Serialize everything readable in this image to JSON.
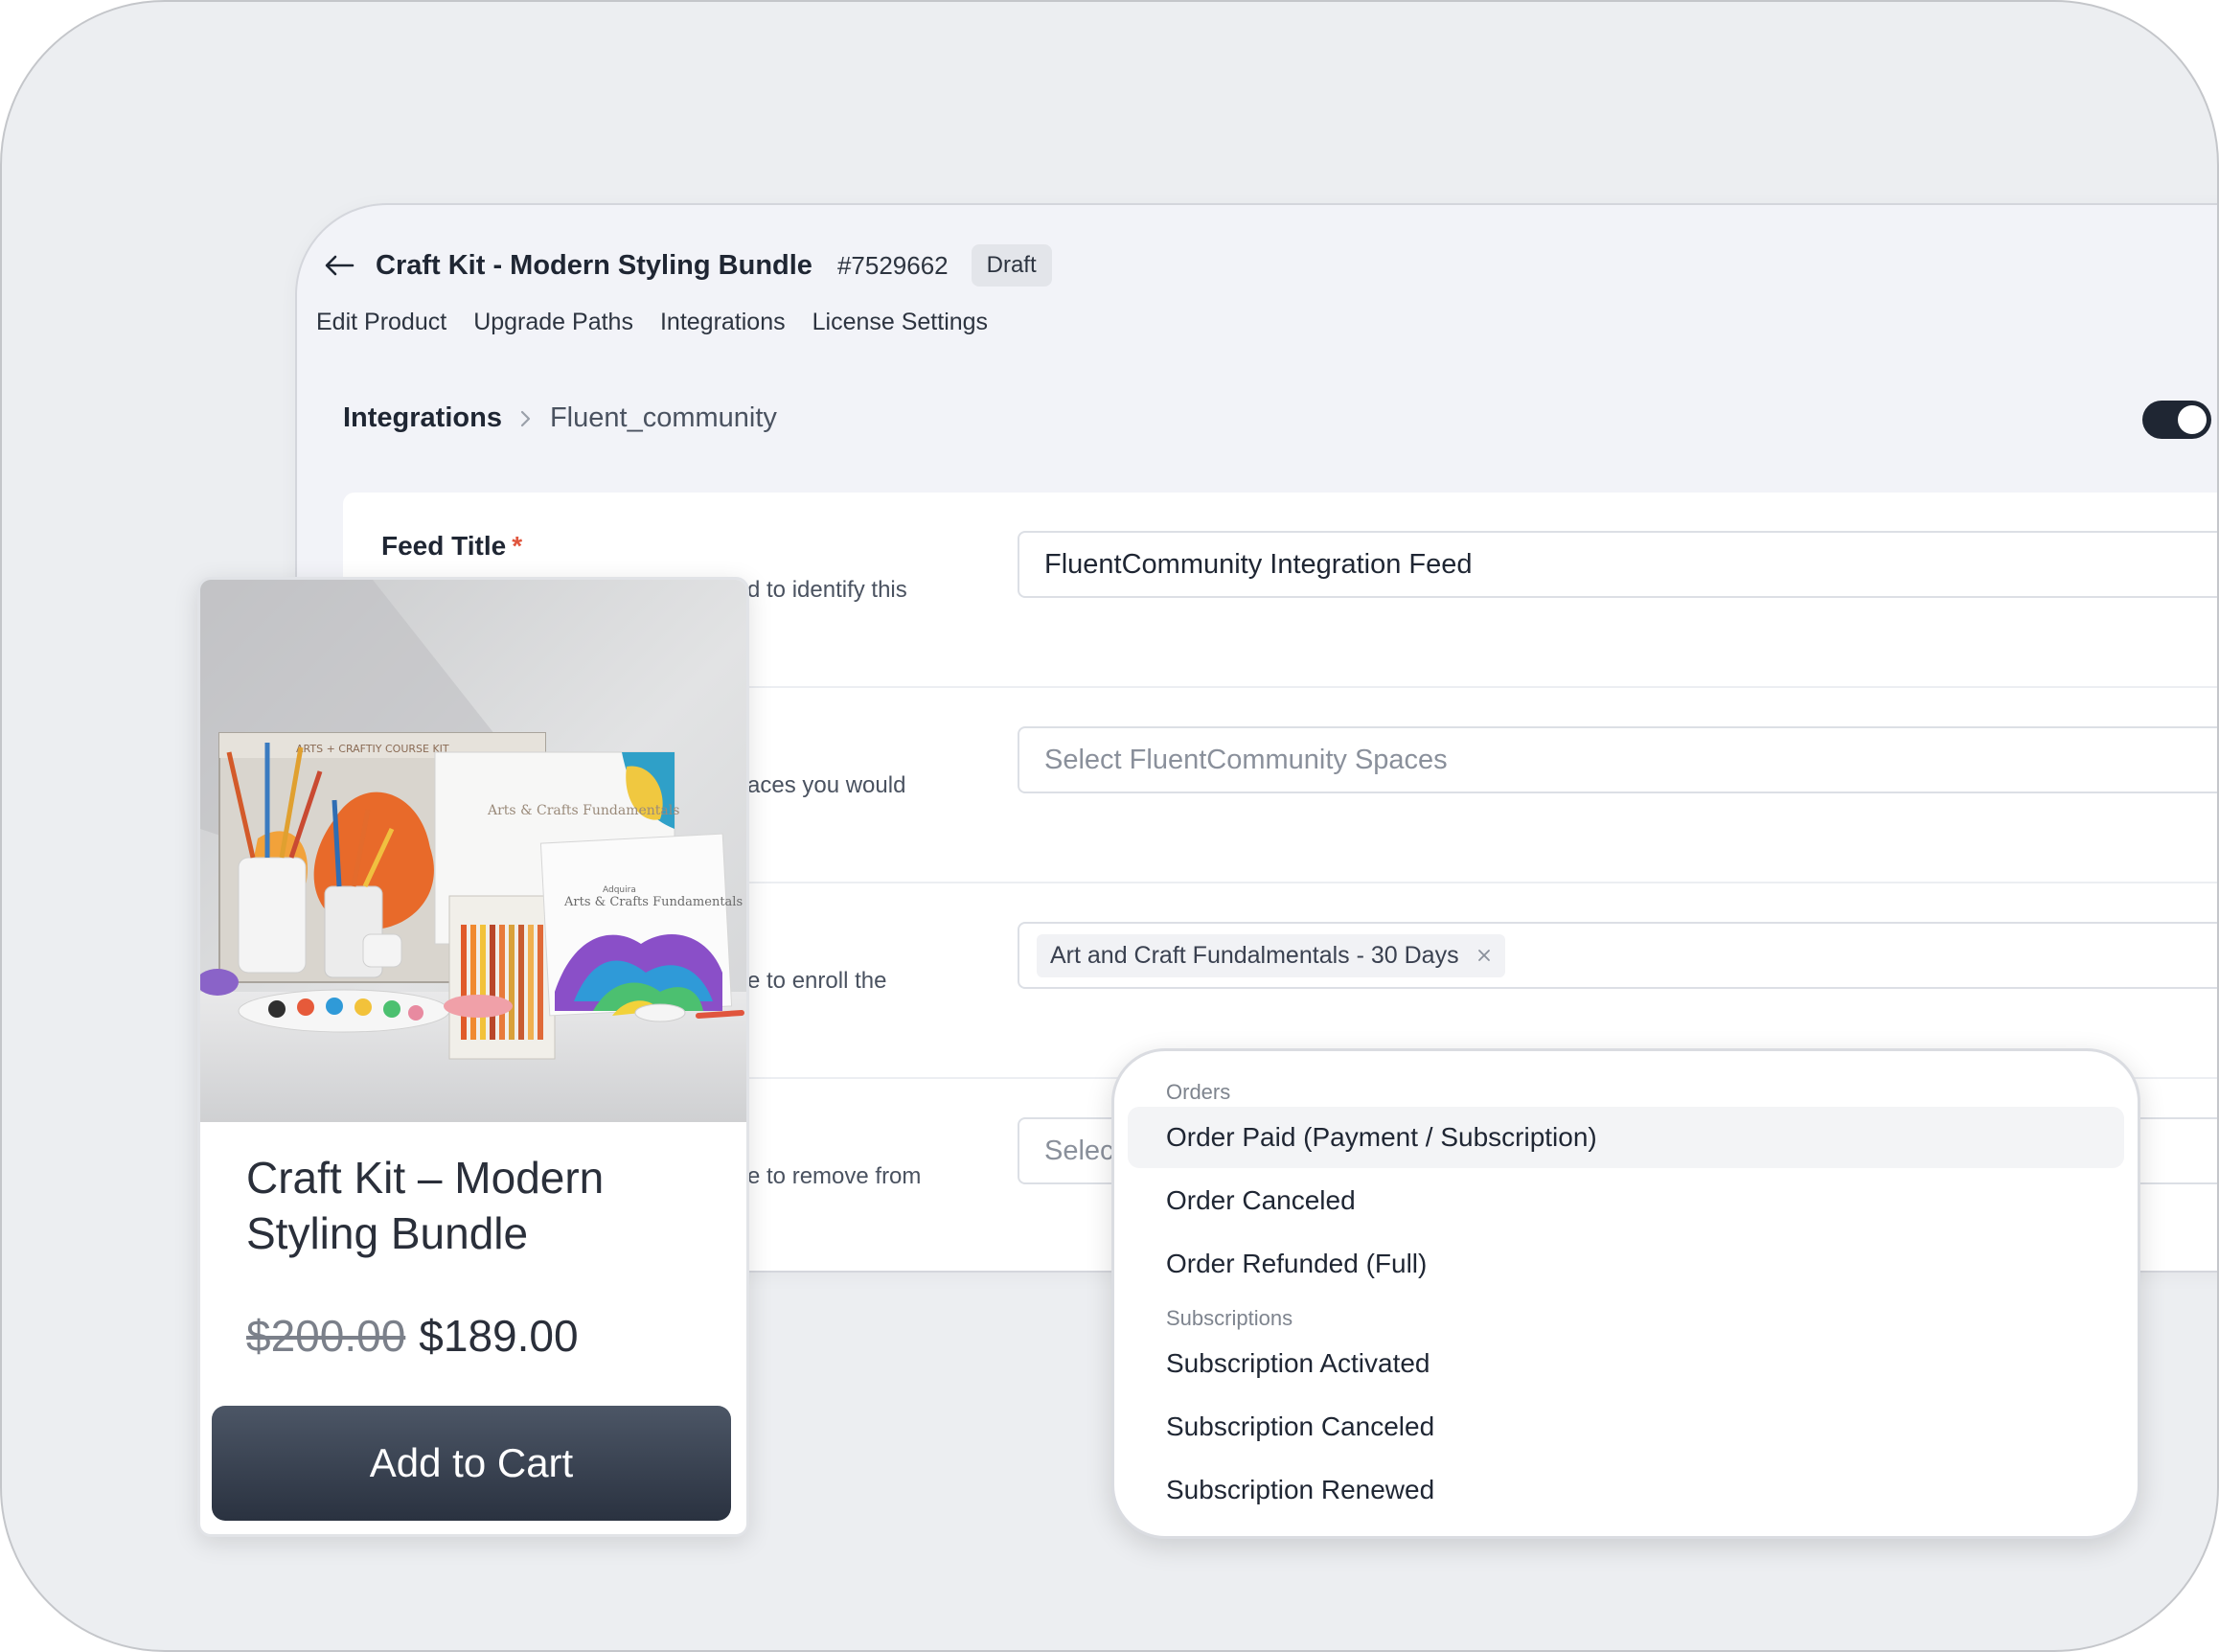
{
  "header": {
    "product_title": "Craft Kit - Modern Styling Bundle",
    "product_id": "#7529662",
    "status": "Draft"
  },
  "tabs": [
    {
      "label": "Edit Product"
    },
    {
      "label": "Upgrade Paths"
    },
    {
      "label": "Integrations"
    },
    {
      "label": "License Settings"
    }
  ],
  "breadcrumb": {
    "root": "Integrations",
    "current": "Fluent_community"
  },
  "toggle": {
    "enabled": true
  },
  "form": {
    "feed_title": {
      "label": "Feed Title",
      "required_mark": "*",
      "help_fragment": "d to identify this",
      "value": "FluentCommunity Integration Feed"
    },
    "spaces": {
      "help_fragment": "aces you would",
      "placeholder": "Select FluentCommunity Spaces"
    },
    "courses": {
      "help_fragment": "e to enroll the",
      "chip": "Art and Craft Fundalmentals - 30 Days"
    },
    "remove": {
      "help_fragment": "e to remove from",
      "placeholder_fragment": "Selec"
    }
  },
  "product_card": {
    "title": "Craft Kit – Modern Styling Bundle",
    "old_price": "$200.00",
    "new_price": "$189.00",
    "add_to_cart": "Add to Cart",
    "image_box_text": "ARTS + CRAFTIY COURSE KIT",
    "image_book1_title": "Arts & Crafts Fundamentals",
    "image_book2_title": "Arts & Crafts Fundamentals",
    "image_brand": "Adquira"
  },
  "dropdown": {
    "groups": [
      {
        "label": "Orders",
        "items": [
          {
            "label": "Order Paid (Payment / Subscription)",
            "active": true
          },
          {
            "label": "Order Canceled"
          },
          {
            "label": "Order Refunded (Full)"
          }
        ]
      },
      {
        "label": "Subscriptions",
        "items": [
          {
            "label": "Subscription Activated"
          },
          {
            "label": "Subscription Canceled"
          },
          {
            "label": "Subscription Renewed"
          }
        ]
      }
    ]
  },
  "colors": {
    "background": "#eceef1",
    "panel": "#f2f3f8",
    "text_primary": "#1f2633",
    "required": "#e0553d",
    "toggle_on": "#1f2633",
    "button": "#2a3240"
  },
  "icons": {
    "back": "arrow-left-icon",
    "breadcrumb_separator": "chevron-right-icon",
    "chip_remove": "close-icon"
  }
}
